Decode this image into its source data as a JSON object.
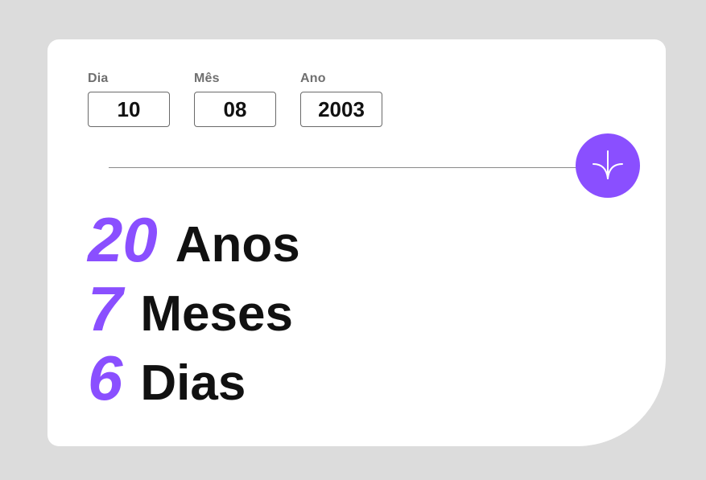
{
  "inputs": {
    "day": {
      "label": "Dia",
      "value": "10"
    },
    "month": {
      "label": "Mês",
      "value": "08"
    },
    "year": {
      "label": "Ano",
      "value": "2003"
    }
  },
  "submit": {
    "icon": "arrow-down-icon"
  },
  "colors": {
    "accent": "#8a4fff",
    "text": "#111111",
    "label": "#6f6f6f",
    "background": "#dcdcdc",
    "card": "#ffffff"
  },
  "results": {
    "years": {
      "value": "20",
      "unit": "Anos"
    },
    "months": {
      "value": "7",
      "unit": "Meses"
    },
    "days": {
      "value": "6",
      "unit": "Dias"
    }
  }
}
